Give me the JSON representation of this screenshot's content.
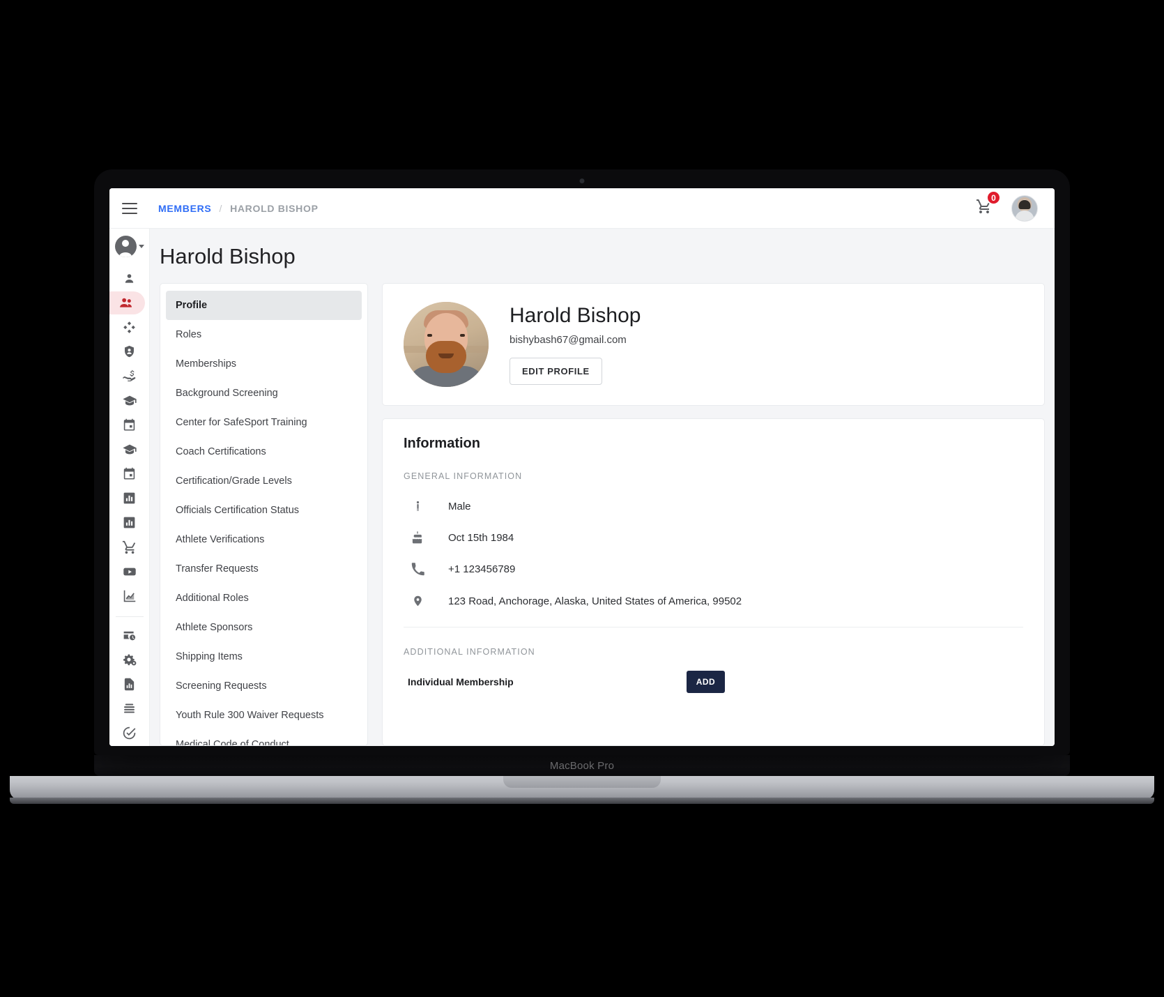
{
  "device": {
    "label": "MacBook Pro"
  },
  "colors": {
    "accent_blue": "#2f6df6",
    "blob_blue": "#2f63ec",
    "blob_pink": "#fb8294",
    "rail_active_bg": "#fae3e5",
    "rail_active_fg": "#c0272d",
    "badge_red": "#e01b2c",
    "add_button_navy": "#1b2644"
  },
  "topbar": {
    "menu_icon": "hamburger-icon",
    "breadcrumb": {
      "root": "MEMBERS",
      "separator": "/",
      "current": "HAROLD BISHOP"
    },
    "cart_icon": "shopping-cart-icon",
    "cart_badge": "0",
    "avatar_icon": "user-avatar"
  },
  "rail": {
    "profile_icon": "account-circle-icon",
    "caret_icon": "chevron-down-icon",
    "items": [
      {
        "icon": "person-icon",
        "name": "person",
        "active": false
      },
      {
        "icon": "people-group-icon",
        "name": "members",
        "active": true
      },
      {
        "icon": "diamond-cluster-icon",
        "name": "clubs",
        "active": false
      },
      {
        "icon": "shield-person-icon",
        "name": "background-screening",
        "active": false
      },
      {
        "icon": "hand-dollar-icon",
        "name": "payments",
        "active": false
      },
      {
        "icon": "graduation-cap-icon",
        "name": "training",
        "active": false
      },
      {
        "icon": "calendar-icon",
        "name": "events",
        "active": false
      },
      {
        "icon": "graduation-cap-icon",
        "name": "courses",
        "active": false
      },
      {
        "icon": "calendar-icon",
        "name": "schedule",
        "active": false
      },
      {
        "icon": "bar-chart-box-icon",
        "name": "reports",
        "active": false
      },
      {
        "icon": "bar-chart-box-icon",
        "name": "statistics",
        "active": false
      },
      {
        "icon": "shopping-cart-icon",
        "name": "store",
        "active": false
      },
      {
        "icon": "video-play-icon",
        "name": "videos",
        "active": false
      },
      {
        "icon": "line-chart-icon",
        "name": "analytics",
        "active": false
      }
    ],
    "bottom_items": [
      {
        "icon": "card-clock-icon",
        "name": "billing-history"
      },
      {
        "icon": "gears-icon",
        "name": "settings"
      },
      {
        "icon": "file-chart-icon",
        "name": "documents"
      },
      {
        "icon": "stacked-lines-icon",
        "name": "logs"
      },
      {
        "icon": "check-circle-icon",
        "name": "tasks"
      }
    ]
  },
  "page": {
    "title": "Harold Bishop"
  },
  "nav": {
    "items": [
      {
        "label": "Profile",
        "active": true
      },
      {
        "label": "Roles",
        "active": false
      },
      {
        "label": "Memberships",
        "active": false
      },
      {
        "label": "Background Screening",
        "active": false
      },
      {
        "label": "Center for SafeSport Training",
        "active": false
      },
      {
        "label": "Coach Certifications",
        "active": false
      },
      {
        "label": "Certification/Grade Levels",
        "active": false
      },
      {
        "label": "Officials Certification Status",
        "active": false
      },
      {
        "label": "Athlete Verifications",
        "active": false
      },
      {
        "label": "Transfer Requests",
        "active": false
      },
      {
        "label": "Additional Roles",
        "active": false
      },
      {
        "label": "Athlete Sponsors",
        "active": false
      },
      {
        "label": "Shipping Items",
        "active": false
      },
      {
        "label": "Screening Requests",
        "active": false
      },
      {
        "label": "Youth Rule 300 Waiver Requests",
        "active": false
      },
      {
        "label": "Medical Code of Conduct",
        "active": false
      }
    ]
  },
  "profile": {
    "photo_alt": "profile-photo",
    "name": "Harold Bishop",
    "email": "bishybash67@gmail.com",
    "edit_button": "EDIT PROFILE"
  },
  "information": {
    "title": "Information",
    "general_label": "GENERAL INFORMATION",
    "rows": [
      {
        "icon": "gender-person-icon",
        "value": "Male"
      },
      {
        "icon": "birthday-cake-icon",
        "value": "Oct 15th 1984"
      },
      {
        "icon": "phone-icon",
        "value": "+1 123456789"
      },
      {
        "icon": "map-pin-icon",
        "value": "123 Road, Anchorage, Alaska, United States of America, 99502"
      }
    ],
    "additional_label": "ADDITIONAL INFORMATION",
    "additional_row": {
      "label": "Individual Membership",
      "button": "ADD"
    }
  }
}
